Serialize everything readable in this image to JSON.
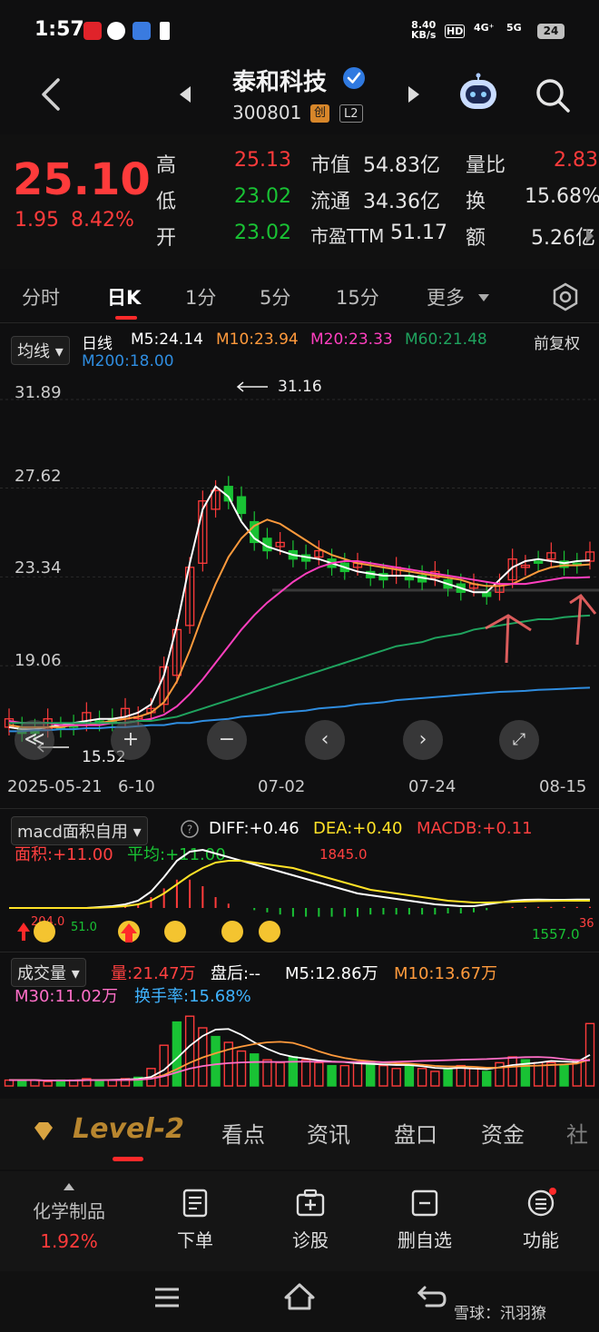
{
  "status": {
    "time": "1:57",
    "net_speed": "8.40",
    "net_unit": "KB/s",
    "hd": "HD",
    "sig1": "4G⁺",
    "sig2": "5G",
    "battery": "24"
  },
  "header": {
    "stock_name": "泰和科技",
    "stock_code": "300801",
    "tag_chuang": "创",
    "tag_level": "L2"
  },
  "quote": {
    "price": "25.10",
    "change": "1.95",
    "change_pct": "8.42%",
    "high_label": "高",
    "high": "25.13",
    "low_label": "低",
    "low": "23.02",
    "open_label": "开",
    "open": "23.02",
    "mcap_label": "市值",
    "mcap": "54.83亿",
    "float_label": "流通",
    "float": "34.36亿",
    "pe_label": "市盈TTM",
    "pe": "51.17",
    "vol_ratio_label": "量比",
    "vol_ratio": "2.83",
    "turnover_label": "换",
    "turnover": "15.68%",
    "amount_label": "额",
    "amount": "5.26亿"
  },
  "period_tabs": [
    "分时",
    "日K",
    "1分",
    "5分",
    "15分",
    "更多"
  ],
  "kline": {
    "ma_selector": "均线",
    "day_label": "日线",
    "m5": "M5:24.14",
    "m10": "M10:23.94",
    "m20": "M20:23.33",
    "m60": "M60:21.48",
    "m200": "M200:18.00",
    "adjust": "前复权",
    "y_ticks": [
      "31.89",
      "27.62",
      "23.34",
      "19.06"
    ],
    "high_mark": "31.16",
    "low_mark": "15.52",
    "x_ticks": [
      "2025-05-21",
      "6-10",
      "07-02",
      "07-24",
      "08-15"
    ]
  },
  "macd": {
    "selector": "macd面积自用",
    "diff": "DIFF:+0.46",
    "dea": "DEA:+0.40",
    "macdb": "MACDB:+0.11",
    "area": "面积:+11.00",
    "avg": "平均:+11.00",
    "peak_label": "1845.0",
    "neg_label": "1557.0",
    "left_label1": "204.0",
    "left_label2": "51.0",
    "right_label": "36"
  },
  "volume": {
    "selector": "成交量",
    "vol": "量:21.47万",
    "after": "盘后:-- ",
    "m5": "M5:12.86万",
    "m10": "M10:13.67万",
    "m30": "M30:11.02万",
    "turnover": "换手率:15.68%"
  },
  "bottom_tabs": {
    "level2": "Level-2",
    "items": [
      "看点",
      "资讯",
      "盘口",
      "资金",
      "社"
    ]
  },
  "toolbar": {
    "sector_name": "化学制品",
    "sector_pct": "1.92%",
    "items": [
      "下单",
      "诊股",
      "删自选",
      "功能"
    ]
  },
  "watermark": "雪球：汛羽獠",
  "colors": {
    "up": "#ff3b3b",
    "down": "#19c234",
    "m5": "#ffffff",
    "m10": "#ff9a3c",
    "m20": "#ff3fbf",
    "m60": "#1fa35e",
    "m200": "#2f8de0"
  },
  "chart_data": [
    {
      "type": "candlestick",
      "title": "",
      "ylim": [
        15.52,
        31.89
      ],
      "y_ticks": [
        31.89,
        27.62,
        23.34,
        19.06
      ],
      "x_ticks": [
        "2025-05-21",
        "6-10",
        "07-02",
        "07-24",
        "08-15"
      ],
      "series": [
        {
          "name": "M5",
          "values": [
            16.1,
            16.0,
            16.0,
            16.1,
            16.2,
            16.3,
            16.4,
            16.5,
            16.5,
            16.6,
            16.8,
            17.2,
            18.6,
            21.0,
            24.0,
            26.6,
            27.7,
            27.2,
            26.0,
            25.2,
            24.8,
            24.6,
            24.4,
            24.3,
            24.2,
            24.0,
            23.8,
            23.6,
            23.5,
            23.4,
            23.4,
            23.4,
            23.3,
            23.2,
            23.0,
            22.8,
            22.6,
            22.6,
            23.2,
            23.8,
            24.1,
            24.2,
            24.1,
            24.0,
            24.1,
            24.14
          ]
        },
        {
          "name": "M10",
          "values": [
            16.2,
            16.1,
            16.1,
            16.1,
            16.1,
            16.2,
            16.2,
            16.3,
            16.4,
            16.5,
            16.6,
            16.8,
            17.3,
            18.3,
            19.8,
            21.5,
            23.0,
            24.3,
            25.2,
            25.8,
            26.1,
            25.9,
            25.5,
            25.1,
            24.7,
            24.4,
            24.2,
            24.0,
            23.9,
            23.8,
            23.7,
            23.6,
            23.5,
            23.4,
            23.3,
            23.2,
            23.0,
            22.9,
            22.9,
            23.0,
            23.3,
            23.6,
            23.8,
            23.9,
            23.9,
            23.94
          ]
        },
        {
          "name": "M20",
          "values": [
            16.4,
            16.3,
            16.3,
            16.3,
            16.2,
            16.2,
            16.2,
            16.2,
            16.3,
            16.3,
            16.4,
            16.5,
            16.7,
            17.1,
            17.7,
            18.4,
            19.2,
            20.0,
            20.8,
            21.5,
            22.1,
            22.6,
            23.1,
            23.5,
            23.8,
            24.0,
            24.1,
            24.1,
            24.0,
            23.9,
            23.8,
            23.7,
            23.6,
            23.5,
            23.4,
            23.3,
            23.2,
            23.1,
            23.0,
            23.0,
            23.0,
            23.1,
            23.2,
            23.3,
            23.3,
            23.33
          ]
        },
        {
          "name": "M60",
          "values": [
            16.3,
            16.3,
            16.3,
            16.3,
            16.3,
            16.3,
            16.3,
            16.3,
            16.3,
            16.3,
            16.4,
            16.4,
            16.5,
            16.6,
            16.8,
            17.0,
            17.2,
            17.4,
            17.6,
            17.8,
            18.0,
            18.2,
            18.4,
            18.6,
            18.8,
            19.0,
            19.2,
            19.4,
            19.6,
            19.8,
            20.0,
            20.1,
            20.2,
            20.4,
            20.5,
            20.6,
            20.8,
            20.9,
            21.0,
            21.1,
            21.2,
            21.3,
            21.3,
            21.4,
            21.45,
            21.48
          ]
        },
        {
          "name": "M200",
          "values": [
            15.9,
            15.9,
            15.95,
            15.95,
            16.0,
            16.0,
            16.05,
            16.05,
            16.1,
            16.1,
            16.15,
            16.2,
            16.2,
            16.3,
            16.3,
            16.4,
            16.45,
            16.5,
            16.6,
            16.65,
            16.7,
            16.8,
            16.85,
            16.9,
            17.0,
            17.05,
            17.1,
            17.2,
            17.25,
            17.3,
            17.4,
            17.45,
            17.5,
            17.55,
            17.6,
            17.65,
            17.7,
            17.75,
            17.8,
            17.82,
            17.85,
            17.9,
            17.92,
            17.95,
            17.98,
            18.0
          ]
        }
      ]
    },
    {
      "type": "bar",
      "title": "",
      "series": [
        {
          "name": "DIFF",
          "values": [
            0.0,
            0.0,
            0.0,
            0.0,
            0.0,
            0.0,
            0.0,
            0.05,
            0.1,
            0.2,
            0.4,
            0.9,
            1.7,
            2.6,
            3.1,
            3.2,
            3.0,
            2.8,
            2.6,
            2.4,
            2.2,
            2.0,
            1.8,
            1.6,
            1.4,
            1.2,
            1.0,
            0.8,
            0.7,
            0.6,
            0.5,
            0.4,
            0.3,
            0.2,
            0.15,
            0.1,
            0.1,
            0.2,
            0.3,
            0.4,
            0.45,
            0.46,
            0.45,
            0.45,
            0.46,
            0.46
          ]
        },
        {
          "name": "DEA",
          "values": [
            0.0,
            0.0,
            0.0,
            0.0,
            0.0,
            0.0,
            0.0,
            0.02,
            0.05,
            0.1,
            0.2,
            0.4,
            0.8,
            1.3,
            1.8,
            2.2,
            2.5,
            2.6,
            2.6,
            2.5,
            2.4,
            2.3,
            2.2,
            2.0,
            1.8,
            1.6,
            1.4,
            1.2,
            1.0,
            0.9,
            0.8,
            0.7,
            0.6,
            0.5,
            0.4,
            0.35,
            0.3,
            0.3,
            0.32,
            0.34,
            0.36,
            0.38,
            0.39,
            0.4,
            0.4,
            0.4
          ]
        },
        {
          "name": "MACDB",
          "values": [
            0.0,
            0.0,
            0.0,
            0.0,
            0.0,
            0.0,
            0.0,
            0.1,
            0.1,
            0.2,
            0.4,
            1.0,
            1.8,
            2.6,
            2.6,
            2.0,
            1.0,
            0.4,
            0.0,
            -0.2,
            -0.4,
            -0.6,
            -0.8,
            -0.8,
            -0.8,
            -0.8,
            -0.8,
            -0.8,
            -0.6,
            -0.6,
            -0.6,
            -0.6,
            -0.6,
            -0.6,
            -0.5,
            -0.5,
            -0.4,
            -0.2,
            0.0,
            0.1,
            0.1,
            0.1,
            0.1,
            0.1,
            0.1,
            0.11
          ]
        }
      ]
    },
    {
      "type": "bar",
      "title": "",
      "series": [
        {
          "name": "量",
          "values": [
            2,
            2,
            2,
            1.5,
            2,
            2,
            2.5,
            2,
            2,
            2.5,
            3,
            6,
            14,
            22,
            24,
            20,
            17,
            15,
            12,
            11,
            9,
            8,
            10,
            9,
            8,
            7,
            7,
            8,
            8,
            7,
            6,
            7,
            6,
            5,
            6,
            7,
            6,
            5,
            8,
            10,
            9,
            8,
            8,
            7,
            9,
            21.47
          ]
        }
      ]
    }
  ]
}
